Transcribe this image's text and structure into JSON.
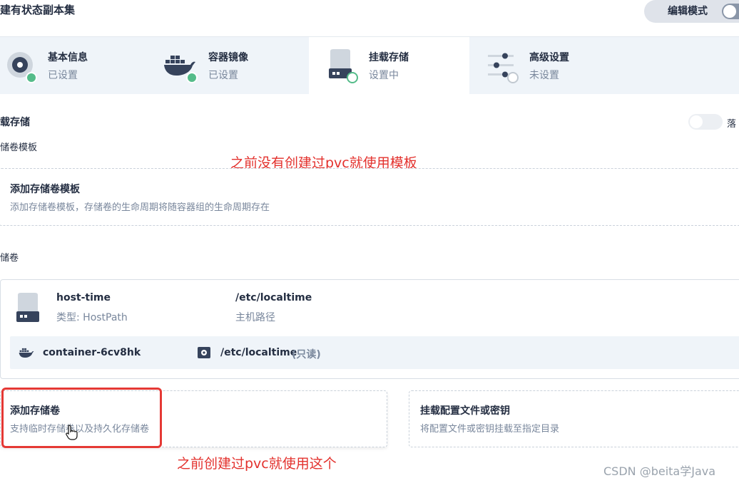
{
  "header": {
    "title": "建有状态副本集",
    "edit_mode_label": "编辑模式"
  },
  "steps": [
    {
      "title": "基本信息",
      "status": "已设置",
      "icon": "settings-disc-icon",
      "state_icon": "check-dot"
    },
    {
      "title": "容器镜像",
      "status": "已设置",
      "icon": "docker-whale-icon",
      "state_icon": "check-dot"
    },
    {
      "title": "挂载存储",
      "status": "设置中",
      "icon": "storage-drive-icon",
      "state_icon": "in-progress-dot"
    },
    {
      "title": "高级设置",
      "status": "未设置",
      "icon": "sliders-icon",
      "state_icon": "pending-dot"
    }
  ],
  "section": {
    "title": "载存储",
    "toggle_text": "落",
    "template_label": "储卷模板",
    "volumes_label": "储卷"
  },
  "annotations": {
    "top": "之前没有创建过pvc就使用模板",
    "bottom": "之前创建过pvc就使用这个"
  },
  "template_card": {
    "title": "添加存储卷模板",
    "desc": "添加存储卷模板，存储卷的生命周期将随容器组的生命周期存在"
  },
  "volume": {
    "name": "host-time",
    "type": "类型: HostPath",
    "path": "/etc/localtime",
    "path_label": "主机路径",
    "container": "container-6cv8hk",
    "mount_path": "/etc/localtime",
    "mount_mode": "(只读)"
  },
  "add_volume_card": {
    "title": "添加存储卷",
    "desc": "支持临时存储卷以及持久化存储卷"
  },
  "mount_config_card": {
    "title": "挂载配置文件或密钥",
    "desc": "将配置文件或密钥挂载至指定目录"
  },
  "watermark": "CSDN @beita学Java",
  "colors": {
    "accent_green": "#55bc8a",
    "annotation_red": "#e3312d",
    "step_bar_bg": "#eff4f9"
  }
}
